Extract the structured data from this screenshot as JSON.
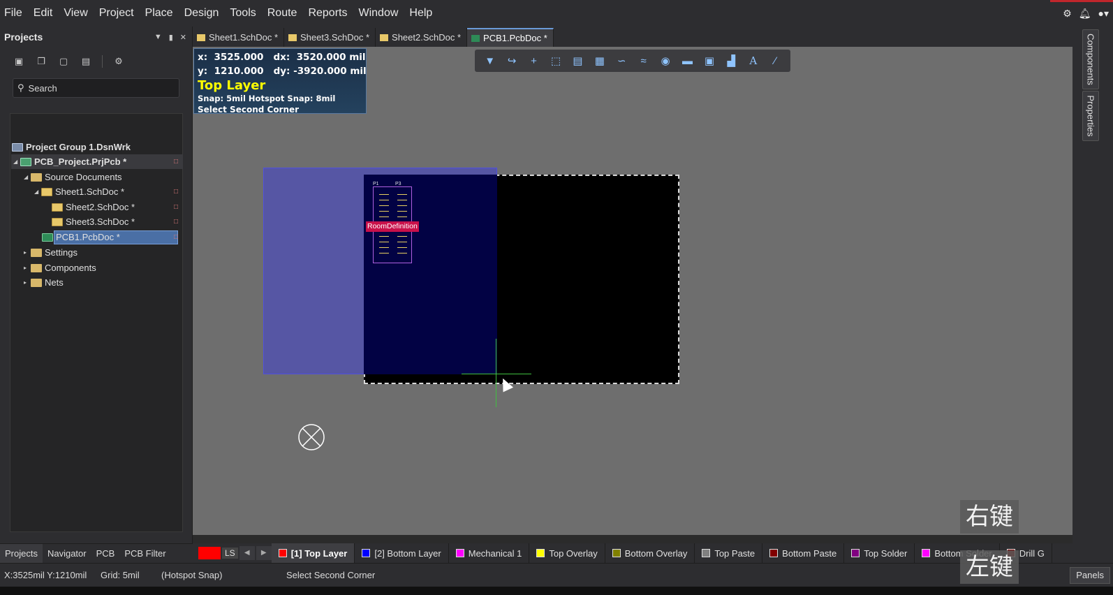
{
  "menu": [
    "File",
    "Edit",
    "View",
    "Project",
    "Place",
    "Design",
    "Tools",
    "Route",
    "Reports",
    "Window",
    "Help"
  ],
  "menu_right_icons": [
    "gear-icon",
    "bell-icon",
    "user-icon"
  ],
  "projects_panel": {
    "title": "Projects",
    "search_placeholder": "Search",
    "tree": {
      "group": "Project Group 1.DsnWrk",
      "project": "PCB_Project.PrjPcb *",
      "source_documents": "Source Documents",
      "sheet1": "Sheet1.SchDoc *",
      "sheet2": "Sheet2.SchDoc *",
      "sheet3": "Sheet3.SchDoc *",
      "pcb1": "PCB1.PcbDoc *",
      "settings": "Settings",
      "components": "Components",
      "nets": "Nets"
    },
    "bottom_tabs": [
      "Projects",
      "Navigator",
      "PCB",
      "PCB Filter"
    ]
  },
  "doc_tabs": [
    "Sheet1.SchDoc *",
    "Sheet3.SchDoc *",
    "Sheet2.SchDoc *",
    "PCB1.PcbDoc *"
  ],
  "hud": {
    "line1": "x:  3525.000   dx:  3520.000 mil",
    "line2": "y:  1210.000   dy: -3920.000 mil",
    "layer": "Top Layer",
    "snap": "Snap: 5mil Hotspot Snap: 8mil",
    "command": "Select Second Corner"
  },
  "canvas": {
    "room_label": "RoomDefinition",
    "designator_left": "P1",
    "designator_right": "P3"
  },
  "watermarks": {
    "right_click": "右键",
    "left_click": "左键"
  },
  "right_panels": [
    "Components",
    "Properties"
  ],
  "layer_bar": {
    "ls_label": "LS",
    "layers": [
      {
        "name": "[1] Top Layer",
        "color": "#ff0000",
        "active": true
      },
      {
        "name": "[2] Bottom Layer",
        "color": "#0000ff"
      },
      {
        "name": "Mechanical 1",
        "color": "#ff00ff"
      },
      {
        "name": "Top Overlay",
        "color": "#ffff00"
      },
      {
        "name": "Bottom Overlay",
        "color": "#808000"
      },
      {
        "name": "Top Paste",
        "color": "#808080"
      },
      {
        "name": "Bottom Paste",
        "color": "#800000"
      },
      {
        "name": "Top Solder",
        "color": "#800080"
      },
      {
        "name": "Bottom Solder",
        "color": "#ff00ff"
      },
      {
        "name": "Drill G",
        "color": "#800000"
      }
    ]
  },
  "status": {
    "coords": "X:3525mil Y:1210mil",
    "grid": "Grid: 5mil",
    "snap": "(Hotspot Snap)",
    "command": "Select Second Corner",
    "panels_button": "Panels"
  },
  "colors": {
    "accent": "#4a6fa5",
    "board": "#000000",
    "room": "#4646c8",
    "hud_text": "#ffff00"
  }
}
